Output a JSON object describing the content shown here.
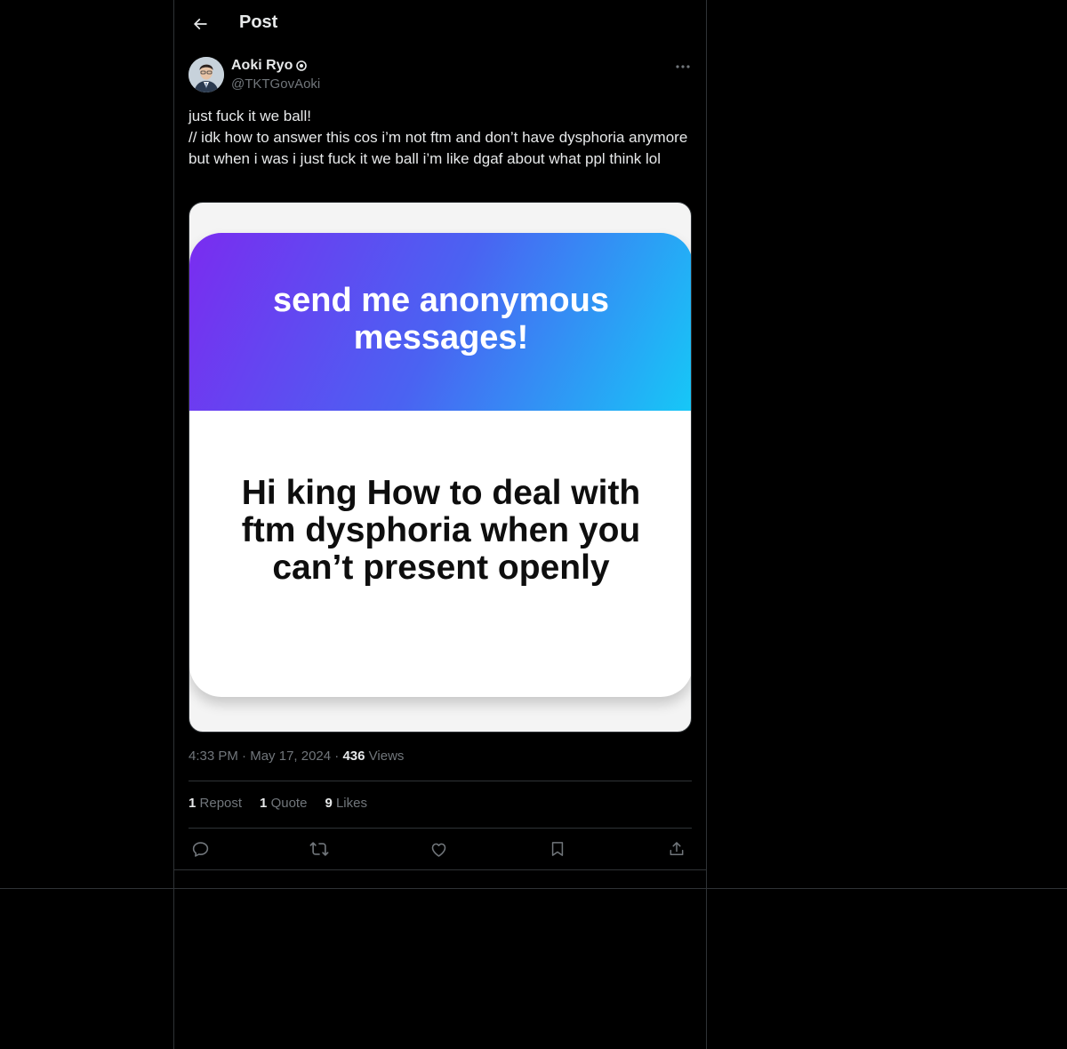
{
  "header": {
    "back_icon": "arrow-left-icon",
    "title": "Post"
  },
  "author": {
    "name": "Aoki Ryo",
    "badge_icon": "affiliate-badge-icon",
    "handle": "@TKTGovAoki"
  },
  "post": {
    "text": "just fuck it we ball!\n// idk how to answer this cos i’m not ftm and don’t have dysphoria anymore but when i was i just fuck it we ball i’m like dgaf about what ppl think lol",
    "image": {
      "banner_text": "send me anonymous messages!",
      "question_text": "Hi king How to deal with ftm dysphoria when you can’t present openly",
      "gradient_colors": [
        "#7a2cf0",
        "#4a63f2",
        "#16c8f7"
      ]
    }
  },
  "meta": {
    "time": "4:33 PM",
    "date": "May 17, 2024",
    "views_count": "436",
    "views_label": "Views"
  },
  "stats": {
    "reposts_count": "1",
    "reposts_label": "Repost",
    "quotes_count": "1",
    "quotes_label": "Quote",
    "likes_count": "9",
    "likes_label": "Likes"
  },
  "actions": [
    "reply-icon",
    "repost-icon",
    "like-icon",
    "bookmark-icon",
    "share-icon"
  ],
  "colors": {
    "background": "#000000",
    "text": "#e7e9ea",
    "muted": "#71767b",
    "border": "#2f3336"
  }
}
